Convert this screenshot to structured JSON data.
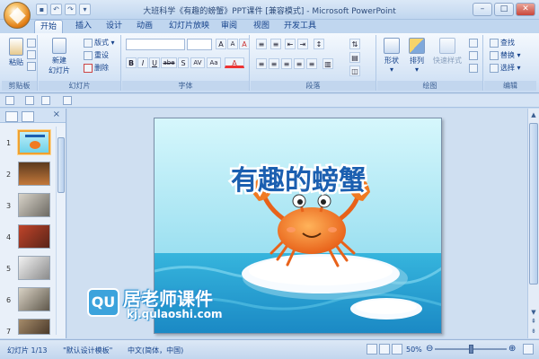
{
  "window": {
    "title": "大班科学《有趣的螃蟹》PPT课件 [兼容模式] - Microsoft PowerPoint"
  },
  "quick_access": [
    "save-icon",
    "undo-icon",
    "redo-icon",
    "customize-icon"
  ],
  "ribbon": {
    "tabs": [
      "开始",
      "插入",
      "设计",
      "动画",
      "幻灯片放映",
      "审阅",
      "视图",
      "开发工具"
    ],
    "active_tab": "开始",
    "clipboard": {
      "paste_label": "粘贴",
      "group_label": "剪贴板"
    },
    "slides": {
      "new_slide_label_1": "新建",
      "new_slide_label_2": "幻灯片",
      "layout_label": "版式",
      "reset_label": "重设",
      "delete_label": "删除",
      "group_label": "幻灯片"
    },
    "font": {
      "group_label": "字体",
      "bold": "B",
      "italic": "I",
      "underline": "U",
      "strike": "abe",
      "shadow": "S",
      "spacing": "AV",
      "case": "Aa",
      "clear": "A",
      "grow": "A",
      "shrink": "A"
    },
    "paragraph": {
      "group_label": "段落"
    },
    "drawing": {
      "shape_label": "形状",
      "arrange_label": "排列",
      "quickstyle_label": "快速样式",
      "group_label": "绘图"
    },
    "editing": {
      "find_label": "查找",
      "replace_label": "替换",
      "select_label": "选择",
      "group_label": "编辑"
    }
  },
  "slide_panel": {
    "slide_numbers": [
      "1",
      "2",
      "3",
      "4",
      "5",
      "6",
      "7"
    ]
  },
  "slide": {
    "title": "有趣的螃蟹",
    "watermark_brand": "居老师课件",
    "watermark_url": "kj.qulaoshi.com",
    "watermark_logo": "QU"
  },
  "status": {
    "slide_counter": "幻灯片 1/13",
    "template": "\"默认设计模板\"",
    "language": "中文(简体，中国)",
    "zoom": "50%"
  },
  "colors": {
    "ribbon_bg": "#dbe8f7",
    "slide_sky": "#7fd7ec",
    "title_blue": "#1b5fb0",
    "crab_orange": "#f07a22"
  }
}
